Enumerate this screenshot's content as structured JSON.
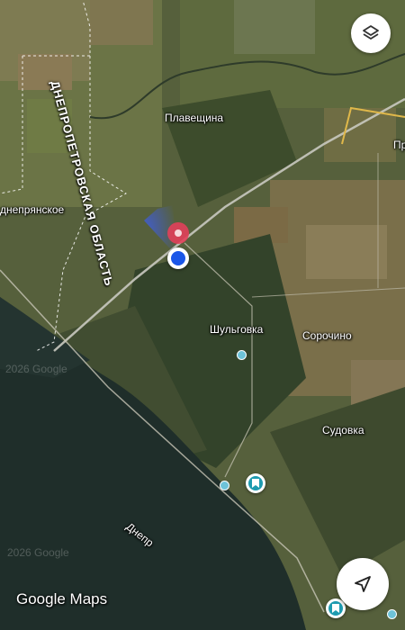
{
  "map": {
    "places": {
      "plaveschina": "Плавещина",
      "shulgovka": "Шульговка",
      "sorochino": "Сорочино",
      "sudovka": "Судовка",
      "dnepryanskoe": "днепрянское",
      "pr_partial": "Пр",
      "dnepr": "Днепр"
    },
    "region_label": "ДНЕПРОПЕТРОВСКАЯ ОБЛАСТЬ",
    "watermarks": [
      "2026 Google",
      "2026 Google"
    ],
    "logo": "Google Maps"
  },
  "controls": {
    "layers_icon": "layers-icon",
    "navigate_icon": "navigation-arrow-icon"
  },
  "colors": {
    "location_dot": "#1a56e8",
    "pin": "#e2405a",
    "poi": "#1e9bb0"
  }
}
